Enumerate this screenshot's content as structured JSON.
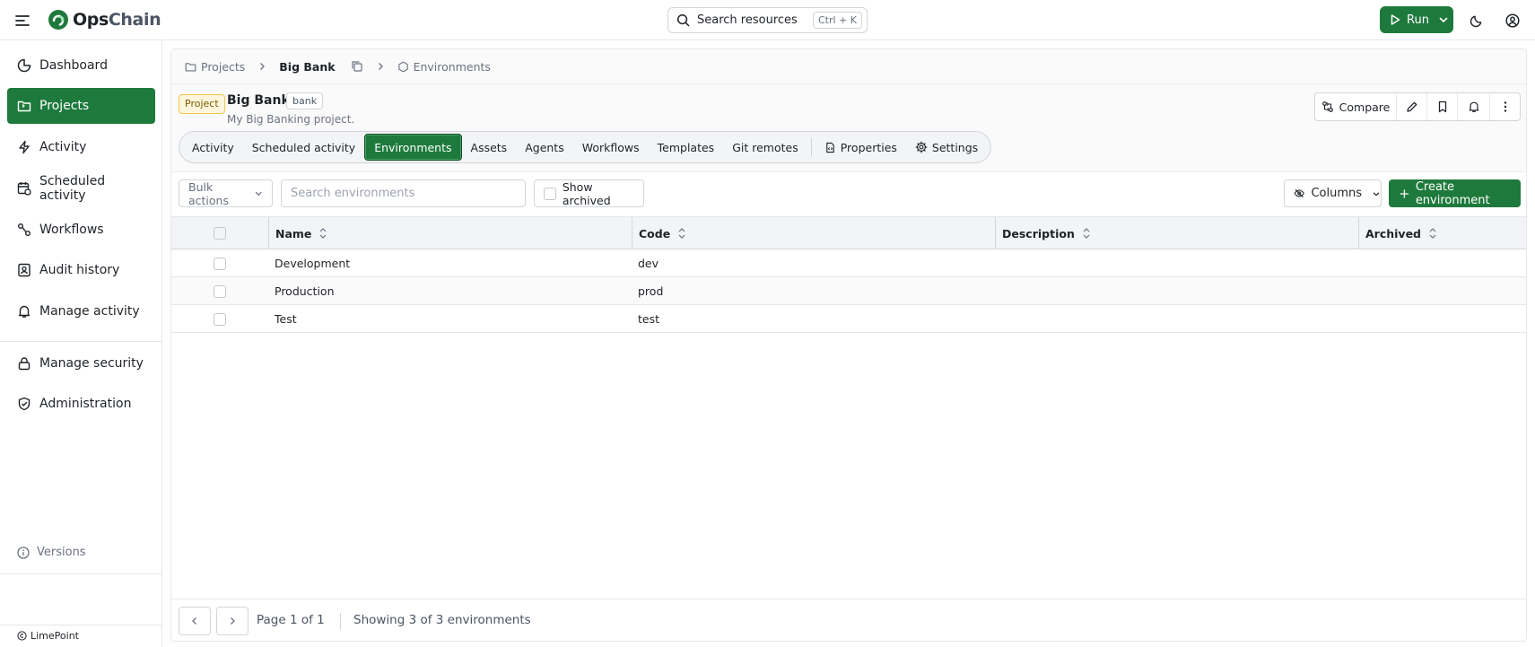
{
  "app": {
    "logo_main": "Ops",
    "logo_accent": "Chain",
    "search_label": "Search resources",
    "search_shortcut": "Ctrl + K",
    "run_label": "Run"
  },
  "sidebar": {
    "items": [
      {
        "label": "Dashboard",
        "icon": "pie-chart-icon"
      },
      {
        "label": "Projects",
        "icon": "folder-icon",
        "active": true
      },
      {
        "label": "Activity",
        "icon": "activity-icon"
      },
      {
        "label": "Scheduled activity",
        "icon": "calendar-clock-icon"
      },
      {
        "label": "Workflows",
        "icon": "workflow-icon"
      },
      {
        "label": "Audit history",
        "icon": "audit-icon"
      },
      {
        "label": "Manage activity",
        "icon": "bell-icon"
      },
      {
        "label": "Manage security",
        "icon": "lock-icon"
      },
      {
        "label": "Administration",
        "icon": "shield-check-icon"
      }
    ],
    "versions_label": "Versions",
    "footer_label": "LimePoint"
  },
  "breadcrumb": {
    "projects": "Projects",
    "project": "Big Bank",
    "current": "Environments"
  },
  "project": {
    "badge": "Project",
    "title": "Big Bank",
    "code": "bank",
    "description": "My Big Banking project."
  },
  "tabs": [
    {
      "label": "Activity"
    },
    {
      "label": "Scheduled activity"
    },
    {
      "label": "Environments",
      "active": true
    },
    {
      "label": "Assets"
    },
    {
      "label": "Agents"
    },
    {
      "label": "Workflows"
    },
    {
      "label": "Templates"
    },
    {
      "label": "Git remotes"
    },
    {
      "label": "Properties",
      "icon": "file-code-icon"
    },
    {
      "label": "Settings",
      "icon": "gear-icon"
    }
  ],
  "actions": {
    "compare_label": "Compare"
  },
  "toolbar": {
    "bulk_label": "Bulk actions",
    "search_placeholder": "Search environments",
    "show_archived_label": "Show archived",
    "columns_label": "Columns",
    "create_label": "Create environment"
  },
  "table": {
    "columns": [
      "Name",
      "Code",
      "Description",
      "Archived"
    ],
    "rows": [
      {
        "name": "Development",
        "code": "dev",
        "description": "",
        "archived": ""
      },
      {
        "name": "Production",
        "code": "prod",
        "description": "",
        "archived": ""
      },
      {
        "name": "Test",
        "code": "test",
        "description": "",
        "archived": ""
      }
    ]
  },
  "pagination": {
    "page_text": "Page 1 of 1",
    "showing_text": "Showing 3 of 3 environments"
  },
  "colors": {
    "accent": "#1e7a3c",
    "project_badge_bg": "#fef6dc",
    "project_badge_border": "#f3c64a"
  }
}
